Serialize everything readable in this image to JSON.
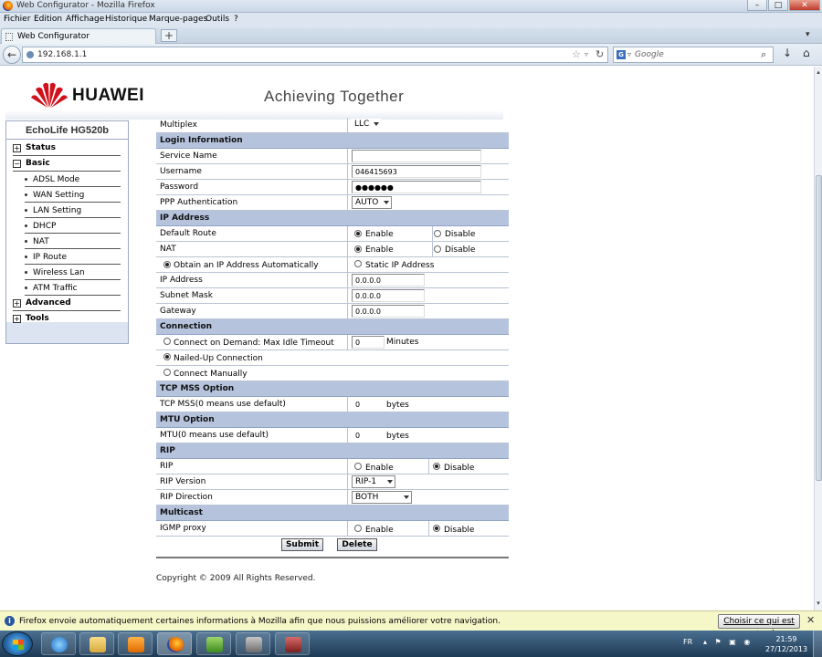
{
  "window": {
    "title": "Web Configurator - Mozilla Firefox",
    "minimize_glyph": "–",
    "maximize_glyph": "□",
    "close_glyph": "✕"
  },
  "menubar": [
    "Fichier",
    "Edition",
    "Affichage",
    "Historique",
    "Marque-pages",
    "Outils",
    "?"
  ],
  "tab": {
    "label": "Web Configurator",
    "new_tab": "+",
    "list_glyph": "▾"
  },
  "navbar": {
    "url": "192.168.1.1",
    "search_placeholder": "Google",
    "search_engine_letter": "G",
    "back_glyph": "←",
    "star_glyph": "☆",
    "drop_glyph": "▿",
    "reload_glyph": "↻",
    "search_glyph": "⌕",
    "download_glyph": "↓",
    "home_glyph": "⌂"
  },
  "header": {
    "brand": "HUAWEI",
    "tagline": "Achieving Together"
  },
  "sidebar": {
    "title": "EchoLife HG520b",
    "items": [
      {
        "label": "Status",
        "toggle": "+"
      },
      {
        "label": "Basic",
        "toggle": "−"
      },
      {
        "label": "ADSL Mode"
      },
      {
        "label": "WAN Setting"
      },
      {
        "label": "LAN Setting"
      },
      {
        "label": "DHCP"
      },
      {
        "label": "NAT"
      },
      {
        "label": "IP Route"
      },
      {
        "label": "Wireless Lan"
      },
      {
        "label": "ATM Traffic"
      },
      {
        "label": "Advanced",
        "toggle": "+"
      },
      {
        "label": "Tools",
        "toggle": "+"
      }
    ]
  },
  "form": {
    "multiplex": {
      "label": "Multiplex",
      "value": "LLC"
    },
    "login_section": "Login Information",
    "service_name": {
      "label": "Service Name",
      "value": ""
    },
    "username": {
      "label": "Username",
      "value": "046415693"
    },
    "password": {
      "label": "Password",
      "value": "●●●●●●"
    },
    "ppp_auth": {
      "label": "PPP Authentication",
      "value": "AUTO"
    },
    "ip_section": "IP Address",
    "default_route": {
      "label": "Default Route",
      "enable": "Enable",
      "disable": "Disable",
      "selected": "enable"
    },
    "nat": {
      "label": "NAT",
      "enable": "Enable",
      "disable": "Disable",
      "selected": "enable"
    },
    "obtain_auto": "Obtain an IP Address Automatically",
    "static_ip": "Static IP Address",
    "ip_address": {
      "label": "IP Address",
      "value": "0.0.0.0"
    },
    "subnet_mask": {
      "label": "Subnet Mask",
      "value": "0.0.0.0"
    },
    "gateway": {
      "label": "Gateway",
      "value": "0.0.0.0"
    },
    "connection_section": "Connection",
    "connect_on_demand": "Connect on Demand: Max Idle Timeout",
    "idle_timeout": {
      "value": "0",
      "unit": "Minutes"
    },
    "nailed_up": "Nailed-Up Connection",
    "connect_manually": "Connect Manually",
    "tcp_mss_section": "TCP MSS Option",
    "tcp_mss": {
      "label": "TCP MSS(0 means use default)",
      "value": "0",
      "unit": "bytes"
    },
    "mtu_section": "MTU Option",
    "mtu": {
      "label": "MTU(0 means use default)",
      "value": "0",
      "unit": "bytes"
    },
    "rip_section": "RIP",
    "rip": {
      "label": "RIP",
      "enable": "Enable",
      "disable": "Disable",
      "selected": "disable"
    },
    "rip_version": {
      "label": "RIP Version",
      "value": "RIP-1"
    },
    "rip_direction": {
      "label": "RIP Direction",
      "value": "BOTH"
    },
    "multicast_section": "Multicast",
    "igmp_proxy": {
      "label": "IGMP proxy",
      "enable": "Enable",
      "disable": "Disable",
      "selected": "disable"
    },
    "submit_label": "Submit",
    "delete_label": "Delete"
  },
  "footer": {
    "copyright": "Copyright © 2009 All Rights Reserved."
  },
  "notification": {
    "message": "Firefox envoie automatiquement certaines informations à Mozilla afin que nous puissions améliorer votre navigation.",
    "button": "Choisir ce qui est partagé",
    "close_glyph": "✕",
    "info_glyph": "i"
  },
  "taskbar": {
    "lang": "FR",
    "tray_glyphs": "▴ ⚑ ▣ ◉",
    "time": "21:59",
    "date": "27/12/2013",
    "apps": [
      "internet-explorer",
      "file-explorer",
      "media-player",
      "firefox",
      "app-5",
      "app-6",
      "app-7"
    ]
  },
  "scrollbar": {
    "up_glyph": "▴",
    "down_glyph": "▾",
    "position": 0.45
  }
}
